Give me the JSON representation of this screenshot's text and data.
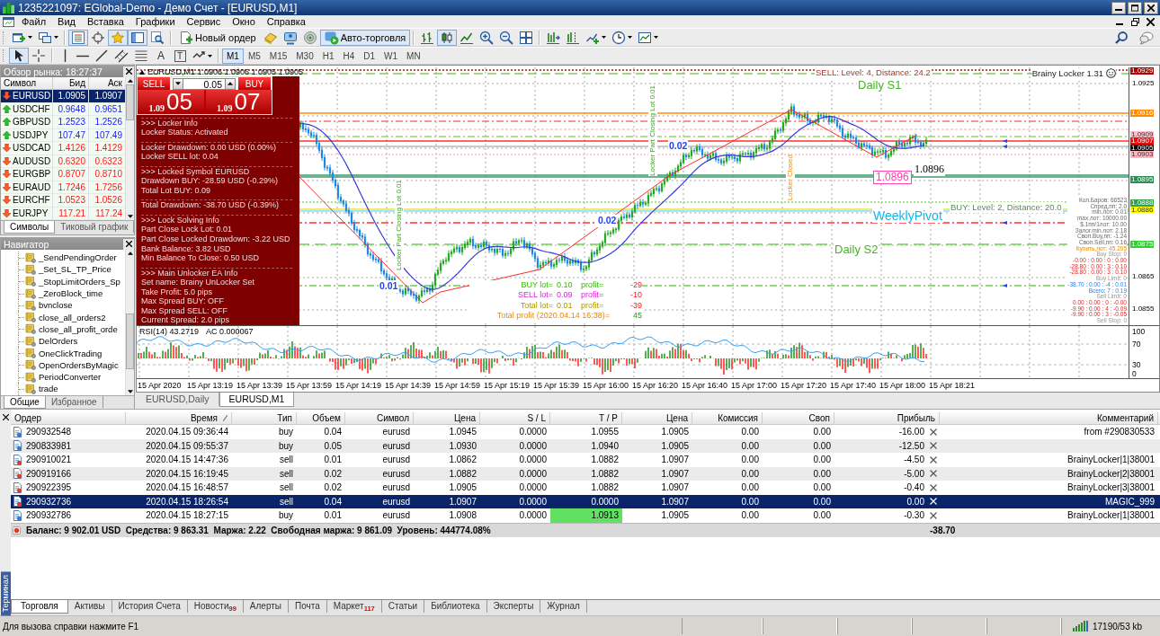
{
  "window": {
    "title": "1235221097: EGlobal-Demo - Демо Счет - [EURUSD,M1]"
  },
  "menu": [
    "Файл",
    "Вид",
    "Вставка",
    "Графики",
    "Сервис",
    "Окно",
    "Справка"
  ],
  "toolbar": {
    "groups": [
      [
        {
          "kind": "new-chart",
          "pressed": false
        },
        {
          "kind": "profiles",
          "pressed": false
        }
      ],
      [
        {
          "kind": "market-watch",
          "pressed": true
        },
        {
          "kind": "navigator",
          "pressed": false
        },
        {
          "kind": "favorites",
          "pressed": true
        },
        {
          "kind": "terminal",
          "pressed": true
        },
        {
          "kind": "tester",
          "pressed": false
        }
      ],
      [
        {
          "kind": "new-order",
          "label": "Новый ордер",
          "pressed": false
        },
        {
          "kind": "editor",
          "pressed": false
        },
        {
          "kind": "community",
          "pressed": false
        },
        {
          "kind": "signals",
          "pressed": false
        },
        {
          "kind": "auto-trading",
          "label": "Авто-торговля",
          "pressed": true
        }
      ],
      [
        {
          "kind": "bar-chart",
          "pressed": false
        },
        {
          "kind": "candles",
          "pressed": true
        },
        {
          "kind": "line-chart",
          "pressed": false
        },
        {
          "kind": "zoom-in",
          "pressed": false
        },
        {
          "kind": "zoom-out",
          "pressed": false
        },
        {
          "kind": "tile",
          "pressed": false
        }
      ],
      [
        {
          "kind": "autoscroll",
          "pressed": false
        },
        {
          "kind": "shift",
          "pressed": false
        },
        {
          "kind": "indicators",
          "pressed": false
        },
        {
          "kind": "periods",
          "pressed": false
        },
        {
          "kind": "templates",
          "pressed": false
        }
      ]
    ]
  },
  "drawing_toolbar": {
    "groups": [
      [
        {
          "kind": "cursor",
          "pressed": true
        },
        {
          "kind": "crosshair",
          "pressed": false
        }
      ],
      [
        {
          "kind": "vline",
          "pressed": false
        },
        {
          "kind": "hline",
          "pressed": false
        },
        {
          "kind": "trendline",
          "pressed": false
        },
        {
          "kind": "channel",
          "pressed": false
        },
        {
          "kind": "fibo",
          "pressed": false
        },
        {
          "kind": "text",
          "glyph": "A",
          "pressed": false
        },
        {
          "kind": "label",
          "glyph": "T",
          "pressed": false
        },
        {
          "kind": "arrows",
          "pressed": false
        }
      ]
    ],
    "timeframes": [
      {
        "label": "M1",
        "selected": true
      },
      {
        "label": "M5",
        "selected": false
      },
      {
        "label": "M15",
        "selected": false
      },
      {
        "label": "M30",
        "selected": false
      },
      {
        "label": "H1",
        "selected": false
      },
      {
        "label": "H4",
        "selected": false
      },
      {
        "label": "D1",
        "selected": false
      },
      {
        "label": "W1",
        "selected": false
      },
      {
        "label": "MN",
        "selected": false
      }
    ]
  },
  "market_watch": {
    "title": "Обзор рынка: 18:27:37",
    "columns": [
      "Символ",
      "Бид",
      "Аск"
    ],
    "rows": [
      {
        "symbol": "EURUSD",
        "bid": "1.0905",
        "ask": "1.0907",
        "up": false,
        "selected": true
      },
      {
        "symbol": "USDCHF",
        "bid": "0.9648",
        "ask": "0.9651",
        "up": true,
        "selected": false
      },
      {
        "symbol": "GBPUSD",
        "bid": "1.2523",
        "ask": "1.2526",
        "up": true,
        "selected": false
      },
      {
        "symbol": "USDJPY",
        "bid": "107.47",
        "ask": "107.49",
        "up": true,
        "selected": false
      },
      {
        "symbol": "USDCAD",
        "bid": "1.4126",
        "ask": "1.4129",
        "up": false,
        "selected": false
      },
      {
        "symbol": "AUDUSD",
        "bid": "0.6320",
        "ask": "0.6323",
        "up": false,
        "selected": false
      },
      {
        "symbol": "EURGBP",
        "bid": "0.8707",
        "ask": "0.8710",
        "up": false,
        "selected": false
      },
      {
        "symbol": "EURAUD",
        "bid": "1.7246",
        "ask": "1.7256",
        "up": false,
        "selected": false
      },
      {
        "symbol": "EURCHF",
        "bid": "1.0523",
        "ask": "1.0526",
        "up": false,
        "selected": false
      },
      {
        "symbol": "EURJPY",
        "bid": "117.21",
        "ask": "117.24",
        "up": false,
        "selected": false
      }
    ],
    "tabs": [
      {
        "label": "Символы",
        "selected": true
      },
      {
        "label": "Тиковый график",
        "selected": false
      }
    ]
  },
  "navigator": {
    "title": "Навигатор",
    "items": [
      "_SendPendingOrder",
      "_Set_SL_TP_Price",
      "_StopLimitOrders_Sp",
      "_ZeroBlock_time",
      "bvnclose",
      "close_all_orders2",
      "close_all_profit_orde",
      "DelOrders",
      "OneClickTrading",
      "OpenOrdersByMagic",
      "PeriodConverter",
      "trade"
    ],
    "tabs": [
      {
        "label": "Общие",
        "selected": true
      },
      {
        "label": "Избранное",
        "selected": false
      }
    ]
  },
  "chart": {
    "header": "EURUSD,M1 1.0906 1.0906 1.0905 1.0905",
    "trade_panel": {
      "sell": "SELL",
      "buy": "BUY",
      "lot": "0.05",
      "bid_head": "1.09",
      "bid_tail": "05",
      "ask_head": "1.09",
      "ask_tail": "07"
    },
    "info_lines": [
      {
        "kind": "divider"
      },
      {
        "kind": "text",
        "text": ">>> Locker Info"
      },
      {
        "kind": "text",
        "text": "Locker Status: Activated"
      },
      {
        "kind": "divider"
      },
      {
        "kind": "text",
        "text": "Locker Drawdown: 0.00 USD (0.00%)"
      },
      {
        "kind": "text",
        "text": "Locker SELL lot: 0.04"
      },
      {
        "kind": "divider"
      },
      {
        "kind": "text",
        "text": ">>> Locked Symbol EURUSD"
      },
      {
        "kind": "text",
        "text": "Drawdown BUY: -28.59 USD (-0.29%)"
      },
      {
        "kind": "text",
        "text": "Total Lot BUY: 0.09"
      },
      {
        "kind": "divider"
      },
      {
        "kind": "text",
        "text": "Total Drawdown: -38.70 USD (-0.39%)"
      },
      {
        "kind": "divider"
      },
      {
        "kind": "text",
        "text": ">>> Lock Solving Info"
      },
      {
        "kind": "text",
        "text": "Part Close Lock Lot: 0.01"
      },
      {
        "kind": "text",
        "text": "Part Close Locked Drawdown: -3.22 USD"
      },
      {
        "kind": "text",
        "text": "Bank Balance: 3.82 USD"
      },
      {
        "kind": "text",
        "text": "Min Balance To Close: 0.50 USD"
      },
      {
        "kind": "divider"
      },
      {
        "kind": "text",
        "text": ">>> Main Unlocker EA Info"
      },
      {
        "kind": "text",
        "text": "Set name: Brainy UnLocker Set"
      },
      {
        "kind": "text",
        "text": "Take Profit: 5.0 pips"
      },
      {
        "kind": "text",
        "text": "Max Spread BUY: OFF"
      },
      {
        "kind": "text",
        "text": "Max Spread SELL: OFF"
      },
      {
        "kind": "text",
        "text": "Current Spread: 2.0 pips"
      }
    ],
    "expert_label": "Brainy Locker 1.31",
    "labels": [
      {
        "kind": "sell-level",
        "text": "SELL: Level: 4, Distance: 24.2"
      },
      {
        "kind": "daily-pivot",
        "text": "Daily S1"
      },
      {
        "kind": "lot",
        "text": "0.02"
      },
      {
        "kind": "lot",
        "text": "0.02"
      },
      {
        "kind": "lot",
        "text": "0.01"
      },
      {
        "kind": "price-tag",
        "text": "1.0896"
      },
      {
        "kind": "price",
        "text": "1.0896"
      },
      {
        "kind": "buy-level",
        "text": "BUY: Level: 2, Distance: 20.0"
      },
      {
        "kind": "weekly-pivot",
        "text": "WeeklyPivot"
      },
      {
        "kind": "daily-pivot",
        "text": "Daily S2"
      }
    ],
    "vertical_labels": [
      {
        "kind": "part-close",
        "text": "Locker Part Closing Lot 0.01"
      },
      {
        "kind": "part-close",
        "text": "Locker Part Closing Lot 0.01"
      },
      {
        "kind": "closed",
        "text": "Locker Closed"
      }
    ],
    "summary": [
      {
        "kind": "buy",
        "label": "BUY lot=",
        "lot": "0.10",
        "profit_label": "profit=",
        "profit": "-29"
      },
      {
        "kind": "sell",
        "label": "SELL lot=",
        "lot": "0.09",
        "profit_label": "profit=",
        "profit": "-10"
      },
      {
        "kind": "net",
        "label": "Total lot=",
        "lot": "0.01",
        "profit_label": "profit=",
        "profit": "-39"
      },
      {
        "kind": "total",
        "label": "Total profit (2020.04.14 16:38)=",
        "profit": "45"
      }
    ],
    "stats": [
      {
        "kind": "info",
        "text": "Кол.Баров: 66523"
      },
      {
        "kind": "info",
        "text": "Спред,пп: 2.0"
      },
      {
        "kind": "info",
        "text": "min.лот: 0.01"
      },
      {
        "kind": "info",
        "text": "max.лот: 10000.00"
      },
      {
        "kind": "info",
        "text": "$.1пп/1лот: 10.00"
      },
      {
        "kind": "info",
        "text": "Залог.min.лот: 2.18"
      },
      {
        "kind": "info",
        "text": "Своп.Buy,пп: -1.24"
      },
      {
        "kind": "info",
        "text": "Своп.Sell,пп: 0.16"
      },
      {
        "kind": "lots",
        "text": "Купить,лот: 45.205"
      },
      {
        "kind": "pending",
        "text": "Buy Stop: 0"
      },
      {
        "kind": "loss",
        "text": "-0.00 : 0.00 : 0 : 0.00"
      },
      {
        "kind": "loss",
        "text": "-28.80 : 0.00 : 3 : 0.10"
      },
      {
        "kind": "loss",
        "text": "-28.80 : 0.00 : 3 : 0.10"
      },
      {
        "kind": "pending",
        "text": "Buy Limit: 0"
      },
      {
        "kind": "total",
        "text": "-38.70 : 0.00 : -4 : 0.01"
      },
      {
        "kind": "total",
        "text": "Всего: 7 : 0.19"
      },
      {
        "kind": "pending",
        "text": "Sell Limit: 0"
      },
      {
        "kind": "loss",
        "text": "0.00 : 0.00 : 0 : -0.00"
      },
      {
        "kind": "loss",
        "text": "-9.90 : 0.00 : 4 : -0.09"
      },
      {
        "kind": "loss",
        "text": "-9.90 : 0.00 : 3 : -0.05"
      },
      {
        "kind": "pending",
        "text": "Sell Stop: 0"
      }
    ],
    "price_axis": [
      {
        "text": "1.0929",
        "color": "#b00000"
      },
      {
        "text": "1.0925"
      },
      {
        "text": "1.0916",
        "color": "#ff8c00"
      },
      {
        "text": "1.0909",
        "color": "#ffc0cb"
      },
      {
        "text": "1.0907",
        "color": "#ff0000"
      },
      {
        "text": "1.0905",
        "color": "#000000"
      },
      {
        "text": "1.0903",
        "color": "#ffb6c1"
      },
      {
        "text": "1.0895",
        "color": "#2e8b57"
      },
      {
        "text": "1.0888",
        "color": "#32a050"
      },
      {
        "text": "1.0886",
        "color": "#ffff00"
      },
      {
        "text": "1.0875",
        "color": "#32cd32"
      },
      {
        "text": "1.0865"
      },
      {
        "text": "1.0855"
      }
    ],
    "indicator_labels": [
      "RSI(14) 43.2719",
      "AC 0.000067"
    ],
    "indicator_scale": [
      "100",
      "70",
      "30",
      "0"
    ],
    "time_axis": [
      "15 Apr 2020",
      "15 Apr 13:19",
      "15 Apr 13:39",
      "15 Apr 13:59",
      "15 Apr 14:19",
      "15 Apr 14:39",
      "15 Apr 14:59",
      "15 Apr 15:19",
      "15 Apr 15:39",
      "15 Apr 16:00",
      "15 Apr 16:20",
      "15 Apr 16:40",
      "15 Apr 17:00",
      "15 Apr 17:20",
      "15 Apr 17:40",
      "15 Apr 18:00",
      "15 Apr 18:21"
    ]
  },
  "chart_tabs": [
    {
      "label": "EURUSD,Daily",
      "selected": false
    },
    {
      "label": "EURUSD,M1",
      "selected": true
    }
  ],
  "terminal": {
    "side_label": "Терминал",
    "columns": [
      {
        "label": "Ордер",
        "sorted": false
      },
      {
        "label": "Время",
        "sorted": true
      },
      {
        "label": "Тип",
        "sorted": false
      },
      {
        "label": "Объем",
        "sorted": false
      },
      {
        "label": "Символ",
        "sorted": false
      },
      {
        "label": "Цена",
        "sorted": false
      },
      {
        "label": "S / L",
        "sorted": false
      },
      {
        "label": "T / P",
        "sorted": false
      },
      {
        "label": "Цена",
        "sorted": false
      },
      {
        "label": "Комиссия",
        "sorted": false
      },
      {
        "label": "Своп",
        "sorted": false
      },
      {
        "label": "Прибыль",
        "sorted": false
      },
      {
        "label": "Комментарий",
        "sorted": false
      }
    ],
    "orders": [
      {
        "kind": "buy",
        "order": "290932548",
        "time": "2020.04.15 09:36:44",
        "type": "buy",
        "volume": "0.04",
        "symbol": "eurusd",
        "price": "1.0945",
        "sl": "0.0000",
        "tp": "1.0955",
        "tp_highlight": false,
        "current_price": "1.0905",
        "commission": "0.00",
        "swap": "0.00",
        "profit": "-16.00",
        "comment": "from #290830533",
        "selected": false
      },
      {
        "kind": "buy",
        "order": "290833981",
        "time": "2020.04.15 09:55:37",
        "type": "buy",
        "volume": "0.05",
        "symbol": "eurusd",
        "price": "1.0930",
        "sl": "0.0000",
        "tp": "1.0940",
        "tp_highlight": false,
        "current_price": "1.0905",
        "commission": "0.00",
        "swap": "0.00",
        "profit": "-12.50",
        "selected": false
      },
      {
        "kind": "sell",
        "order": "290910021",
        "time": "2020.04.15 14:47:36",
        "type": "sell",
        "volume": "0.01",
        "symbol": "eurusd",
        "price": "1.0862",
        "sl": "0.0000",
        "tp": "1.0882",
        "tp_highlight": false,
        "current_price": "1.0907",
        "commission": "0.00",
        "swap": "0.00",
        "profit": "-4.50",
        "comment": "BrainyLocker|1|38001",
        "selected": false
      },
      {
        "kind": "sell",
        "order": "290919166",
        "time": "2020.04.15 16:19:45",
        "type": "sell",
        "volume": "0.02",
        "symbol": "eurusd",
        "price": "1.0882",
        "sl": "0.0000",
        "tp": "1.0882",
        "tp_highlight": false,
        "current_price": "1.0907",
        "commission": "0.00",
        "swap": "0.00",
        "profit": "-5.00",
        "comment": "BrainyLocker|2|38001",
        "selected": false
      },
      {
        "kind": "sell",
        "order": "290922395",
        "time": "2020.04.15 16:48:57",
        "type": "sell",
        "volume": "0.02",
        "symbol": "eurusd",
        "price": "1.0905",
        "sl": "0.0000",
        "tp": "1.0882",
        "tp_highlight": false,
        "current_price": "1.0907",
        "commission": "0.00",
        "swap": "0.00",
        "profit": "-0.40",
        "comment": "BrainyLocker|3|38001",
        "selected": false
      },
      {
        "kind": "sell",
        "order": "290932736",
        "time": "2020.04.15 18:26:54",
        "type": "sell",
        "volume": "0.04",
        "symbol": "eurusd",
        "price": "1.0907",
        "sl": "0.0000",
        "tp": "0.0000",
        "tp_highlight": false,
        "current_price": "1.0907",
        "commission": "0.00",
        "swap": "0.00",
        "profit": "0.00",
        "comment": "MAGIC_999",
        "selected": true
      },
      {
        "kind": "buy",
        "order": "290932786",
        "time": "2020.04.15 18:27:15",
        "type": "buy",
        "volume": "0.01",
        "symbol": "eurusd",
        "price": "1.0908",
        "sl": "0.0000",
        "tp": "1.0913",
        "tp_highlight": true,
        "current_price": "1.0905",
        "commission": "0.00",
        "swap": "0.00",
        "profit": "-0.30",
        "comment": "BrainyLocker|1|38001",
        "selected": false
      }
    ],
    "balance": {
      "text": "Баланс: 9 902.01 USD  Средства: 9 863.31  Маржа: 2.22  Свободная маржа: 9 861.09  Уровень: 444774.08%",
      "profit": "-38.70"
    },
    "tabs": [
      {
        "label": "Торговля",
        "selected": true
      },
      {
        "label": "Активы",
        "selected": false
      },
      {
        "label": "История Счета",
        "selected": false
      },
      {
        "label": "Новости",
        "badge": "99",
        "selected": false
      },
      {
        "label": "Алерты",
        "selected": false
      },
      {
        "label": "Почта",
        "selected": false
      },
      {
        "label": "Маркет",
        "badge": "117",
        "selected": false
      },
      {
        "label": "Статьи",
        "selected": false
      },
      {
        "label": "Библиотека",
        "selected": false
      },
      {
        "label": "Эксперты",
        "selected": false
      },
      {
        "label": "Журнал",
        "selected": false
      }
    ]
  },
  "status_bar": {
    "help": "Для вызова справки нажмите F1",
    "traffic": "17190/53 kb"
  }
}
